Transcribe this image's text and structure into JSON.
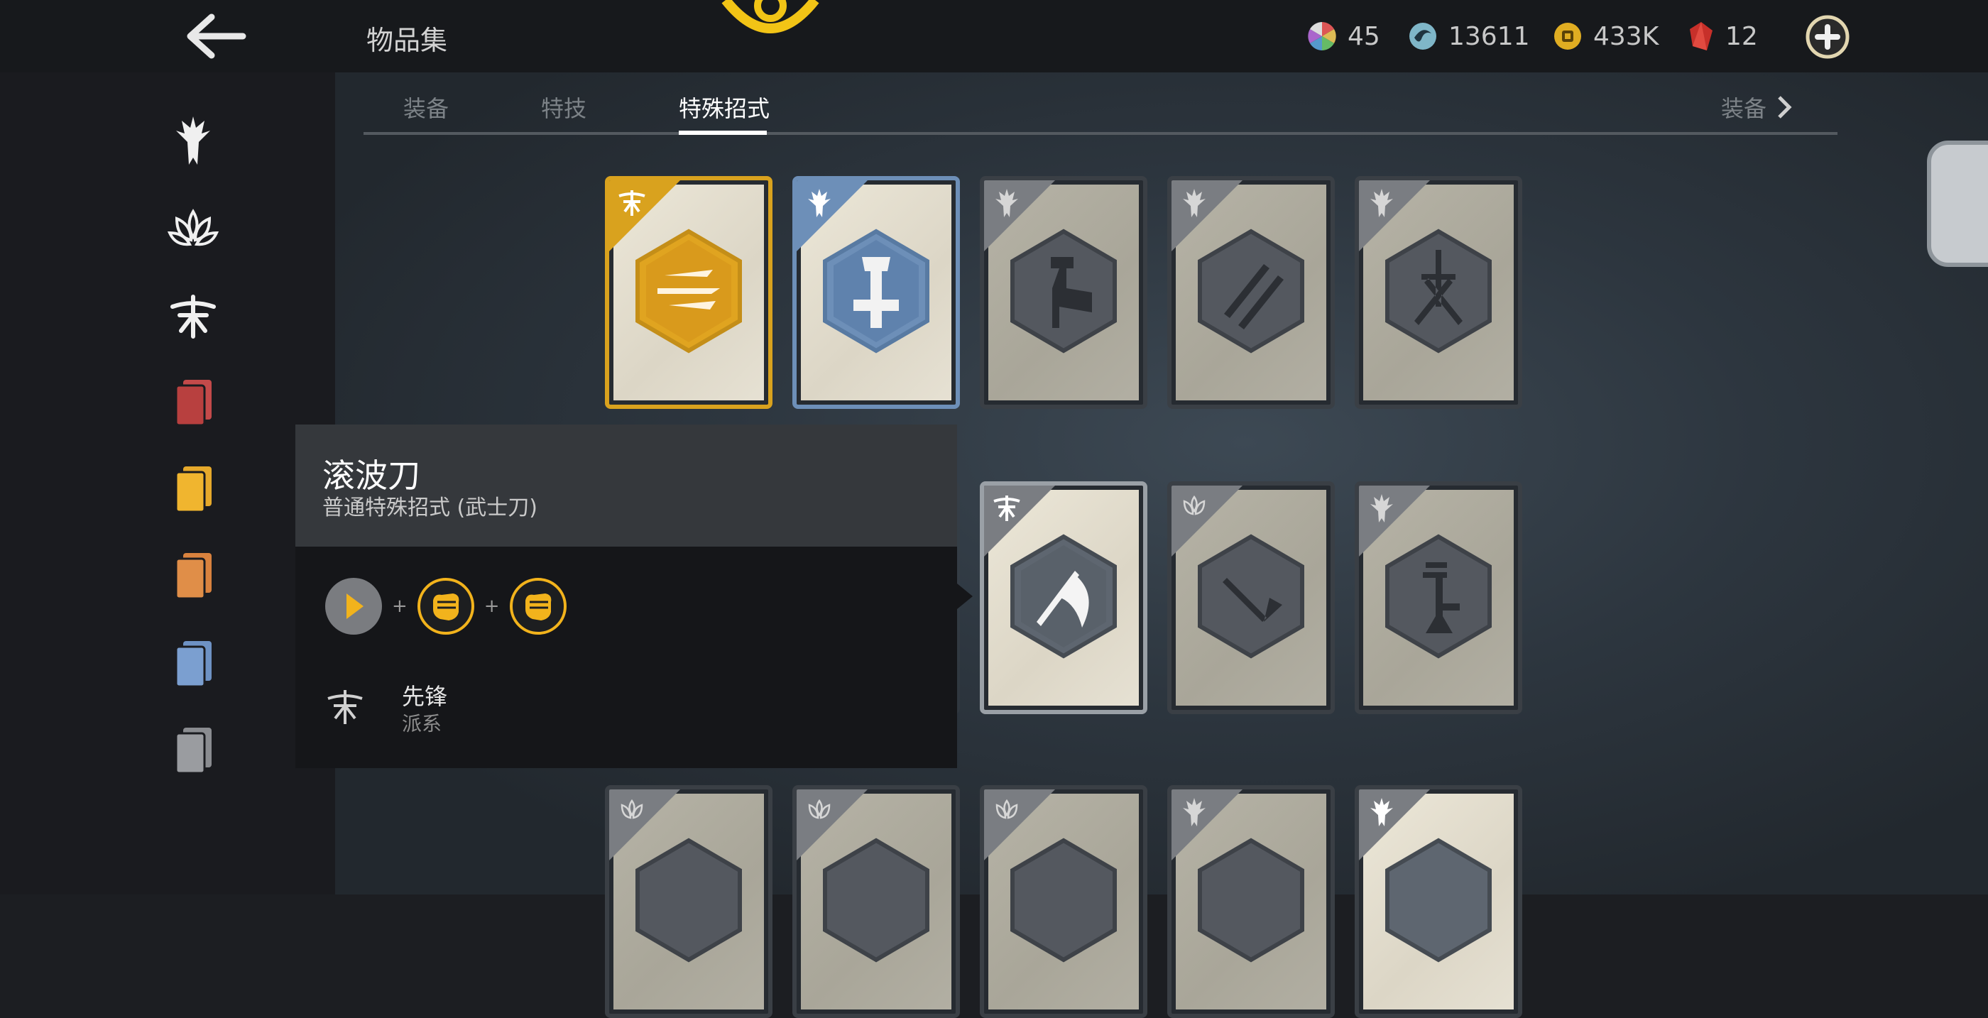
{
  "header": {
    "title": "物品集",
    "back_icon": "back-arrow-icon",
    "emblem_icon": "top-emblem-icon",
    "plus_icon": "plus-circle-icon"
  },
  "currencies": [
    {
      "icon": "color-wheel-icon",
      "value": "45"
    },
    {
      "icon": "steel-swirl-icon",
      "value": "13611"
    },
    {
      "icon": "gold-coin-icon",
      "value": "433K"
    },
    {
      "icon": "red-shard-icon",
      "value": "12"
    }
  ],
  "sidebar": {
    "items": [
      {
        "icon": "knight-faction-icon"
      },
      {
        "icon": "lotus-faction-icon"
      },
      {
        "icon": "vanguard-faction-icon"
      },
      {
        "icon": "red-cards-icon",
        "color": "#c44a4a"
      },
      {
        "icon": "gold-cards-icon",
        "color": "#e6a92b"
      },
      {
        "icon": "orange-cards-icon",
        "color": "#d9823e"
      },
      {
        "icon": "blue-cards-icon",
        "color": "#6e92c4"
      },
      {
        "icon": "grey-cards-icon",
        "color": "#8a8c90"
      }
    ]
  },
  "tabs": [
    {
      "label": "装备"
    },
    {
      "label": "特技"
    },
    {
      "label": "特殊招式"
    }
  ],
  "active_tab": "特殊招式",
  "next_tab": {
    "label": "装备",
    "icon": "chevron-right-icon"
  },
  "tooltip": {
    "name": "滚波刀",
    "subtitle": "普通特殊招式 (武士刀)",
    "combo": [
      {
        "icon": "arrow-button-icon"
      },
      {
        "icon": "fist-icon"
      },
      {
        "icon": "fist-icon"
      }
    ],
    "combo_joiner": "+",
    "faction_name": "先锋",
    "faction_label": "派系"
  },
  "colors": {
    "gold": "#d9a21e",
    "blue": "#6d8fb8",
    "accent": "#f2c416"
  }
}
